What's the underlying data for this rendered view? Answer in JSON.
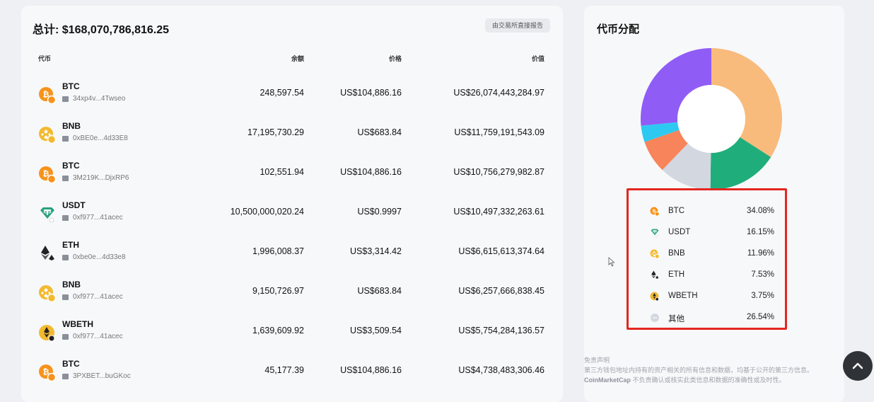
{
  "holdings": {
    "total_label": "总计: $168,070,786,816.25",
    "report_badge": "由交易所直接报告",
    "columns": {
      "coin": "代币",
      "balance": "余额",
      "price": "价格",
      "value": "价值"
    },
    "rows": [
      {
        "symbol": "BTC",
        "icon": "btc-icon",
        "address": "34xp4v...4Twseo",
        "balance": "248,597.54",
        "price": "US$104,886.16",
        "value": "US$26,074,443,284.97"
      },
      {
        "symbol": "BNB",
        "icon": "bnb-icon",
        "address": "0xBE0e...4d33E8",
        "balance": "17,195,730.29",
        "price": "US$683.84",
        "value": "US$11,759,191,543.09"
      },
      {
        "symbol": "BTC",
        "icon": "btc-icon",
        "address": "3M219K...DjxRP6",
        "balance": "102,551.94",
        "price": "US$104,886.16",
        "value": "US$10,756,279,982.87"
      },
      {
        "symbol": "USDT",
        "icon": "usdt-icon",
        "address": "0xf977...41acec",
        "balance": "10,500,000,020.24",
        "price": "US$0.9997",
        "value": "US$10,497,332,263.61"
      },
      {
        "symbol": "ETH",
        "icon": "eth-icon",
        "address": "0xbe0e...4d33e8",
        "balance": "1,996,008.37",
        "price": "US$3,314.42",
        "value": "US$6,615,613,374.64"
      },
      {
        "symbol": "BNB",
        "icon": "bnb-icon",
        "address": "0xf977...41acec",
        "balance": "9,150,726.97",
        "price": "US$683.84",
        "value": "US$6,257,666,838.45"
      },
      {
        "symbol": "WBETH",
        "icon": "wbeth-icon",
        "address": "0xf977...41acec",
        "balance": "1,639,609.92",
        "price": "US$3,509.54",
        "value": "US$5,754,284,136.57"
      },
      {
        "symbol": "BTC",
        "icon": "btc-icon",
        "address": "3PXBET...buGKoc",
        "balance": "45,177.39",
        "price": "US$104,886.16",
        "value": "US$4,738,483,306.46"
      }
    ]
  },
  "distribution": {
    "title": "代币分配",
    "legend": [
      {
        "name": "BTC",
        "percent": "34.08%",
        "icon": "btc-icon"
      },
      {
        "name": "USDT",
        "percent": "16.15%",
        "icon": "usdt-icon"
      },
      {
        "name": "BNB",
        "percent": "11.96%",
        "icon": "bnb-icon"
      },
      {
        "name": "ETH",
        "percent": "7.53%",
        "icon": "eth-icon"
      },
      {
        "name": "WBETH",
        "percent": "3.75%",
        "icon": "wbeth-icon"
      },
      {
        "name": "其他",
        "percent": "26.54%",
        "icon": "other-icon"
      }
    ]
  },
  "chart_data": {
    "type": "pie",
    "categories": [
      "BTC",
      "USDT",
      "BNB",
      "ETH",
      "WBETH",
      "其他"
    ],
    "values": [
      34.08,
      16.15,
      11.96,
      7.53,
      3.75,
      26.54
    ],
    "colors": [
      "#f8bb7c",
      "#1fae7b",
      "#d3d7e0",
      "#f7845a",
      "#2ec9f0",
      "#8f5cf6"
    ],
    "donut": true,
    "title": "代币分配"
  },
  "disclaimer": {
    "title": "免责声明",
    "line1": "第三方钱包地址内持有的资产相关的所有信息和数据，均基于公开的第三方信息。",
    "brand": "CoinMarketCap",
    "line2": " 不负责确认或核实此类信息和数据的准确性或及时性。"
  },
  "colors": {
    "btc": "#f7931a",
    "bnb": "#f3ba2f",
    "usdt": "#26a17b",
    "eth": "#222222",
    "highlight": "#e32620"
  }
}
